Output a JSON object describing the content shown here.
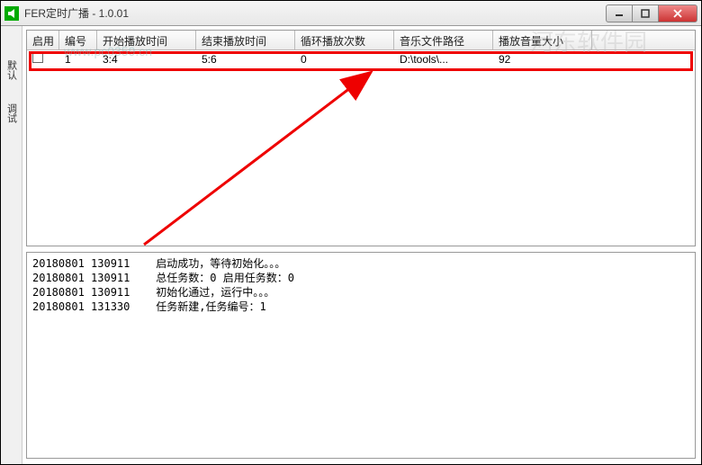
{
  "window": {
    "title": "FER定时广播 - 1.0.01"
  },
  "left_tabs": {
    "tab1": "默认",
    "tab2": "调试"
  },
  "table": {
    "headers": {
      "enable": "启用",
      "id": "编号",
      "start": "开始播放时间",
      "end": "结束播放时间",
      "loop": "循环播放次数",
      "path": "音乐文件路径",
      "volume": "播放音量大小"
    },
    "rows": [
      {
        "enable": false,
        "id": "1",
        "start": "3:4",
        "end": "5:6",
        "loop": "0",
        "path": "D:\\tools\\...",
        "volume": "92"
      }
    ]
  },
  "log": {
    "lines": [
      "20180801 130911    启动成功，等待初始化。。。",
      "20180801 130911    总任务数：0 启用任务数：0",
      "20180801 130911    初始化通过，运行中。。。",
      "20180801 131330    任务新建,任务编号：1"
    ]
  },
  "watermarks": {
    "url": "www.pc0359.cn",
    "brand": "河东软件园"
  }
}
